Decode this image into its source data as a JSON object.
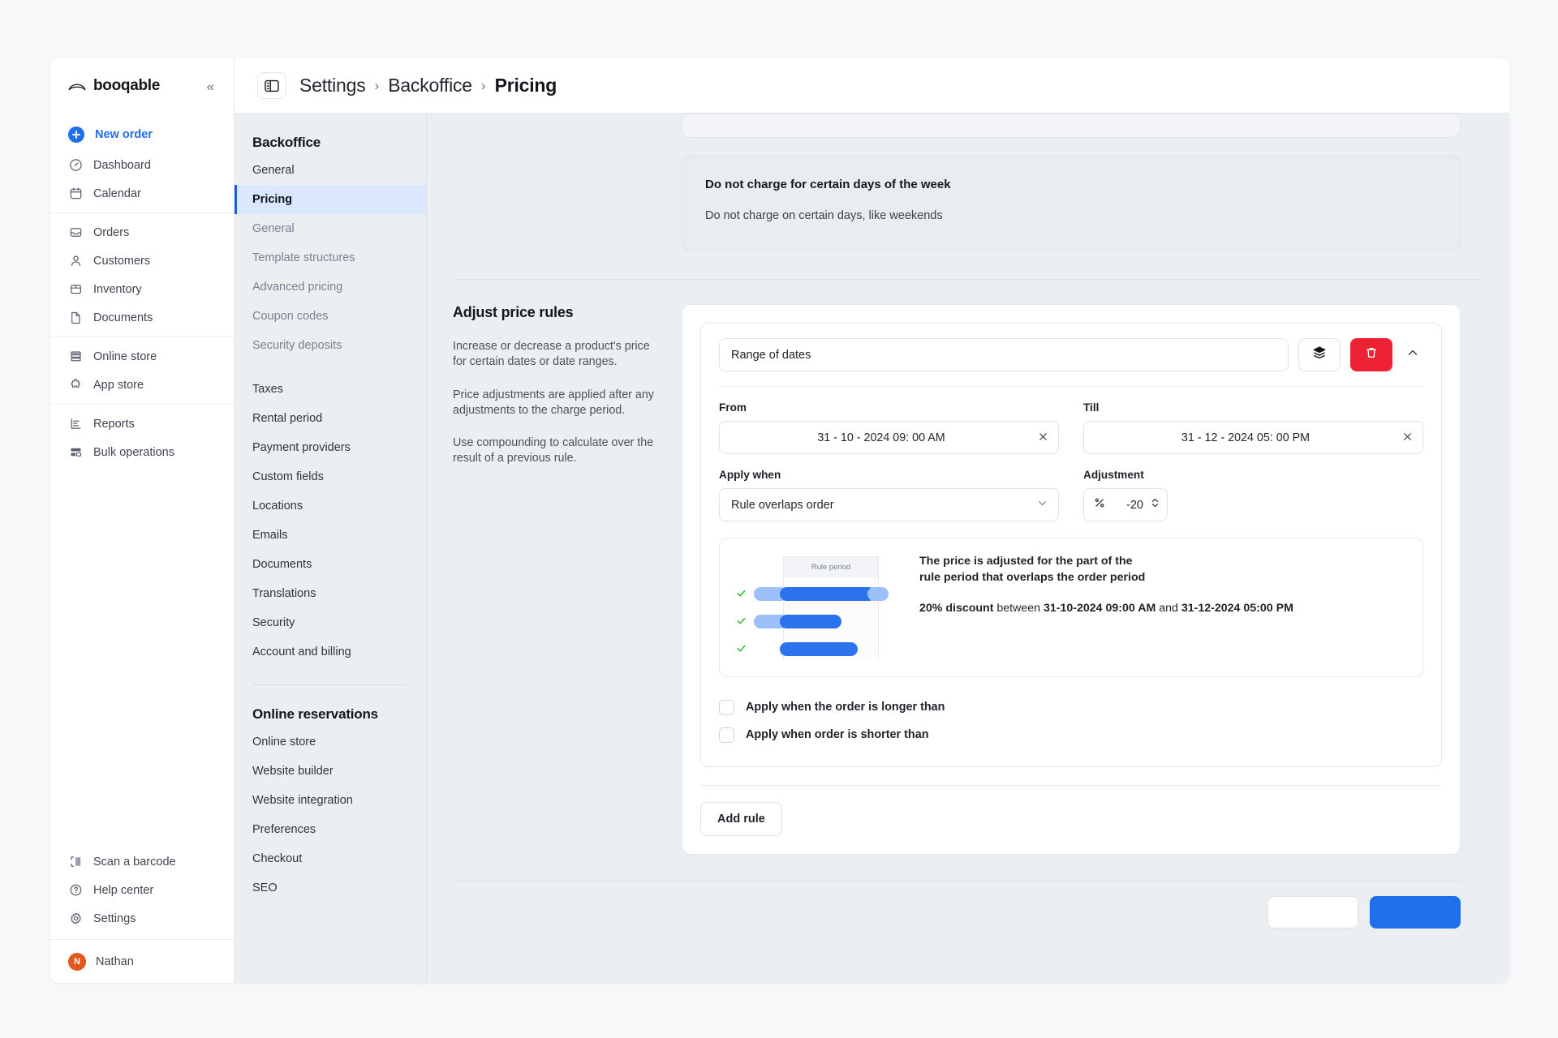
{
  "brand": {
    "name": "booqable",
    "collapse_label": "«"
  },
  "sidebar": {
    "primary": {
      "label": "New order",
      "icon": "plus-icon"
    },
    "groups": [
      {
        "items": [
          {
            "label": "Dashboard",
            "icon": "gauge-icon"
          },
          {
            "label": "Calendar",
            "icon": "calendar-icon"
          }
        ]
      },
      {
        "items": [
          {
            "label": "Orders",
            "icon": "inbox-icon"
          },
          {
            "label": "Customers",
            "icon": "user-icon"
          },
          {
            "label": "Inventory",
            "icon": "box-icon"
          },
          {
            "label": "Documents",
            "icon": "document-icon"
          }
        ]
      },
      {
        "items": [
          {
            "label": "Online store",
            "icon": "store-icon"
          },
          {
            "label": "App store",
            "icon": "puzzle-icon"
          }
        ]
      },
      {
        "items": [
          {
            "label": "Reports",
            "icon": "chart-icon"
          },
          {
            "label": "Bulk operations",
            "icon": "layers-rows-icon"
          }
        ]
      }
    ],
    "bottom": [
      {
        "label": "Scan a barcode",
        "icon": "barcode-scanner-icon"
      },
      {
        "label": "Help center",
        "icon": "question-circle-icon"
      },
      {
        "label": "Settings",
        "icon": "gear-icon"
      }
    ],
    "user": {
      "name": "Nathan",
      "initial": "N",
      "avatar_color": "#e2571b"
    }
  },
  "topbar": {
    "panel_toggle_icon": "sidebar-panel-icon",
    "breadcrumbs": [
      {
        "label": "Settings",
        "current": false
      },
      {
        "label": "Backoffice",
        "current": false
      },
      {
        "label": "Pricing",
        "current": true
      }
    ],
    "separator": "›"
  },
  "settings_nav": {
    "sections": [
      {
        "title": "Backoffice",
        "items": [
          {
            "label": "General",
            "state": "normal"
          },
          {
            "label": "Pricing",
            "state": "active"
          },
          {
            "label": "General",
            "state": "sub"
          },
          {
            "label": "Template structures",
            "state": "sub"
          },
          {
            "label": "Advanced pricing",
            "state": "sub"
          },
          {
            "label": "Coupon codes",
            "state": "sub"
          },
          {
            "label": "Security deposits",
            "state": "sub"
          },
          {
            "label": "Taxes",
            "state": "normal"
          },
          {
            "label": "Rental period",
            "state": "normal"
          },
          {
            "label": "Payment providers",
            "state": "normal"
          },
          {
            "label": "Custom fields",
            "state": "normal"
          },
          {
            "label": "Locations",
            "state": "normal"
          },
          {
            "label": "Emails",
            "state": "normal"
          },
          {
            "label": "Documents",
            "state": "normal"
          },
          {
            "label": "Translations",
            "state": "normal"
          },
          {
            "label": "Security",
            "state": "normal"
          },
          {
            "label": "Account and billing",
            "state": "normal"
          }
        ]
      },
      {
        "title": "Online reservations",
        "items": [
          {
            "label": "Online store",
            "state": "normal"
          },
          {
            "label": "Website builder",
            "state": "normal"
          },
          {
            "label": "Website integration",
            "state": "normal"
          },
          {
            "label": "Preferences",
            "state": "normal"
          },
          {
            "label": "Checkout",
            "state": "normal"
          },
          {
            "label": "SEO",
            "state": "normal"
          }
        ]
      }
    ]
  },
  "main": {
    "info_box": {
      "title": "Do not charge for certain days of the week",
      "body": "Do not charge on certain days, like weekends"
    },
    "adjust_section": {
      "title": "Adjust price rules",
      "paragraphs": [
        "Increase or decrease a product's price for certain dates or date ranges.",
        "Price adjustments are applied after any adjustments to the charge period.",
        "Use compounding to calculate over the result of a previous rule."
      ]
    },
    "rule": {
      "type_value": "Range of dates",
      "compound_icon": "layers-icon",
      "delete_icon": "trash-icon",
      "collapse_icon": "chevron-up-icon",
      "danger_color": "#ee2233",
      "from": {
        "label": "From",
        "value": "31 - 10 - 2024 09: 00 AM",
        "clear_icon": "close-icon"
      },
      "till": {
        "label": "Till",
        "value": "31 - 12 - 2024 05: 00 PM",
        "clear_icon": "close-icon"
      },
      "apply_when": {
        "label": "Apply when",
        "value": "Rule overlaps order",
        "chevron_icon": "chevron-down-icon"
      },
      "adjustment": {
        "label": "Adjustment",
        "unit_icon": "percent-icon",
        "value": "-20",
        "stepper_icon": "stepper-icon"
      },
      "illustration": {
        "rule_period_label": "Rule period",
        "check_icon": "check-icon",
        "accent": "#2b72ed",
        "accent_light": "#9dc0fb",
        "text_line1": "The price is adjusted for the part of the",
        "text_line2": "rule period that overlaps the order period",
        "discount_text": "20% discount",
        "between_word": "between",
        "date_from": "31-10-2024 09:00 AM",
        "and_word": "and",
        "date_till": "31-12-2024 05:00 PM"
      },
      "checkboxes": [
        {
          "label": "Apply when the order is longer than",
          "checked": false
        },
        {
          "label": "Apply when order is shorter than",
          "checked": false
        }
      ]
    },
    "add_rule_label": "Add rule"
  }
}
